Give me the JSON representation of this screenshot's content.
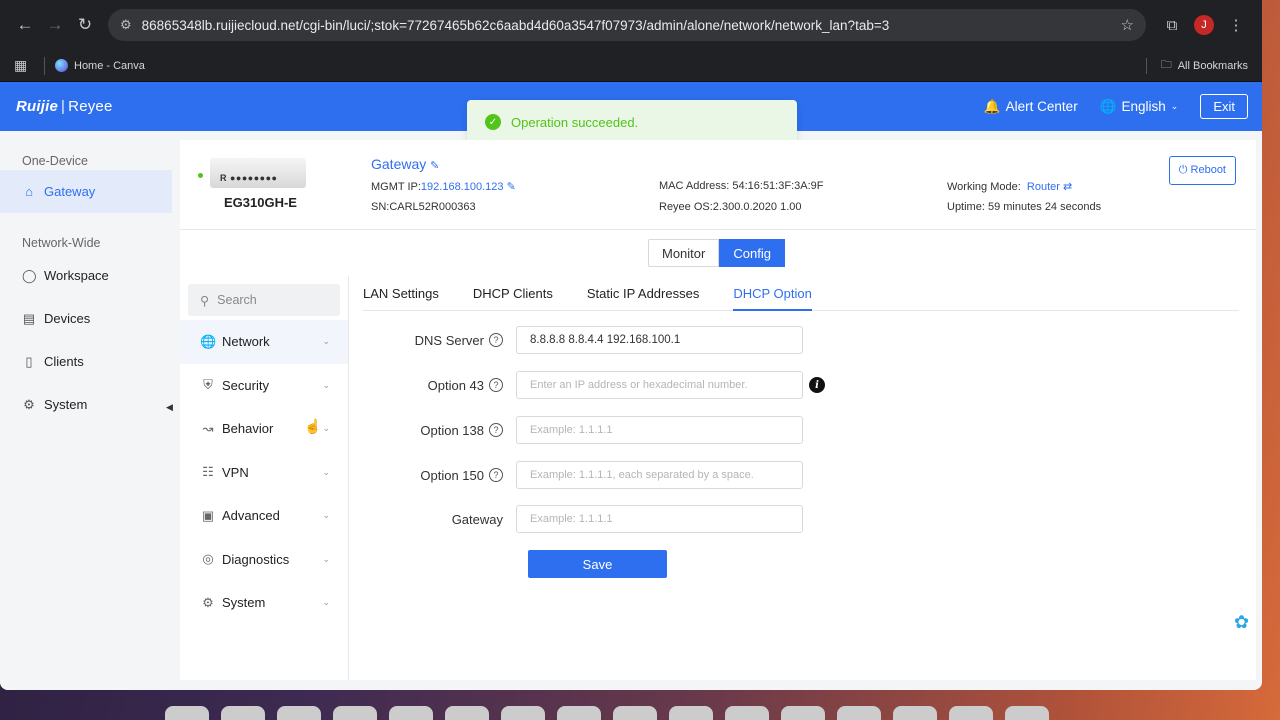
{
  "browser": {
    "url": "86865348lb.ruijiecloud.net/cgi-bin/luci/;stok=77267465b62c6aabd4d60a3547f07973/admin/alone/network/network_lan?tab=3",
    "bookmark": "Home - Canva",
    "all_bookmarks": "All Bookmarks",
    "profile_initial": "J"
  },
  "header": {
    "logo_brand": "Ruijie",
    "logo_sub": "Reyee",
    "alert_center": "Alert Center",
    "language": "English",
    "exit": "Exit"
  },
  "toast": {
    "message": "Operation succeeded."
  },
  "leftnav": {
    "section1": "One-Device",
    "gateway": "Gateway",
    "section2": "Network-Wide",
    "items": [
      "Workspace",
      "Devices",
      "Clients",
      "System"
    ]
  },
  "device": {
    "name": "Gateway",
    "model": "EG310GH-E",
    "mgmt_ip_label": "MGMT IP:",
    "mgmt_ip": "192.168.100.123",
    "sn": "SN:CARL52R000363",
    "mac": "MAC Address: 54:16:51:3F:3A:9F",
    "os": "Reyee OS:2.300.0.2020 1.00",
    "working_mode_label": "Working Mode:",
    "working_mode": "Router",
    "uptime": "Uptime: 59 minutes 24 seconds",
    "reboot": "Reboot",
    "img_letter": "R"
  },
  "mode_toggle": {
    "monitor": "Monitor",
    "config": "Config"
  },
  "subnav": {
    "search_placeholder": "Search",
    "items": [
      "Network",
      "Security",
      "Behavior",
      "VPN",
      "Advanced",
      "Diagnostics",
      "System"
    ]
  },
  "tabs": [
    "LAN Settings",
    "DHCP Clients",
    "Static IP Addresses",
    "DHCP Option"
  ],
  "form": {
    "dns_label": "DNS Server",
    "dns_value": "8.8.8.8 8.8.4.4 192.168.100.1",
    "opt43_label": "Option 43",
    "opt43_placeholder": "Enter an IP address or hexadecimal number.",
    "opt138_label": "Option 138",
    "opt138_placeholder": "Example: 1.1.1.1",
    "opt150_label": "Option 150",
    "opt150_placeholder": "Example: 1.1.1.1, each separated by a space.",
    "gateway_label": "Gateway",
    "gateway_placeholder": "Example: 1.1.1.1",
    "save": "Save"
  }
}
